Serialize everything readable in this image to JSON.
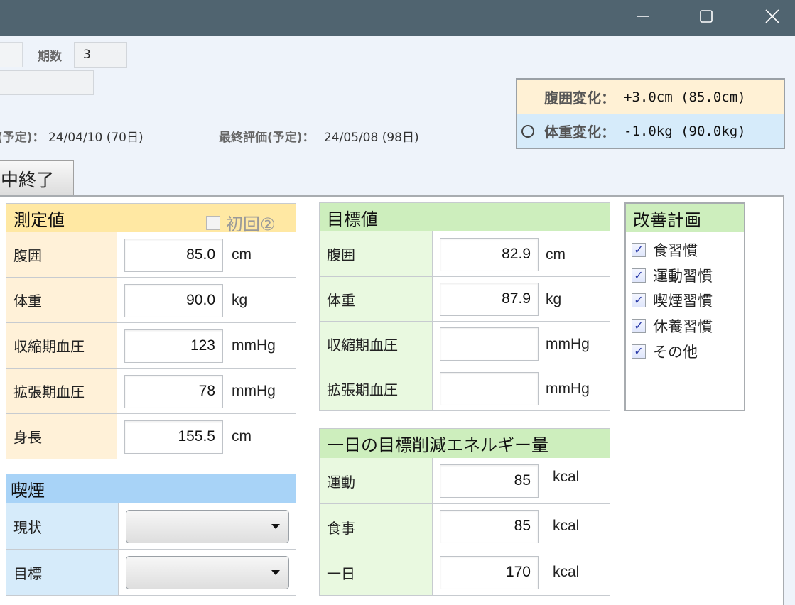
{
  "titlebar": {
    "minimize_icon": "minimize-icon",
    "maximize_icon": "maximize-icon",
    "close_icon": "close-icon"
  },
  "header": {
    "period_label": "期数",
    "period_value": "3",
    "schedule_mid_label": "(予定)：",
    "schedule_mid_value": "24/04/10 (70日)",
    "schedule_final_label": "最終評価(予定)：",
    "schedule_final_value": "24/05/08 (98日)"
  },
  "changes": {
    "waist_label": "腹囲変化：",
    "waist_value": "+3.0cm (85.0cm)",
    "weight_label": "体重変化：",
    "weight_value": "-1.0kg (90.0kg)"
  },
  "tab": {
    "label": "中終了"
  },
  "measurements": {
    "title": "測定値",
    "first_label": "初回②",
    "rows": [
      {
        "label": "腹囲",
        "value": "85.0",
        "unit": "cm"
      },
      {
        "label": "体重",
        "value": "90.0",
        "unit": "kg"
      },
      {
        "label": "収縮期血圧",
        "value": "123",
        "unit": "mmHg"
      },
      {
        "label": "拡張期血圧",
        "value": "78",
        "unit": "mmHg"
      },
      {
        "label": "身長",
        "value": "155.5",
        "unit": "cm"
      }
    ]
  },
  "targets": {
    "title": "目標値",
    "rows": [
      {
        "label": "腹囲",
        "value": "82.9",
        "unit": "cm"
      },
      {
        "label": "体重",
        "value": "87.9",
        "unit": "kg"
      },
      {
        "label": "収縮期血圧",
        "value": "",
        "unit": "mmHg"
      },
      {
        "label": "拡張期血圧",
        "value": "",
        "unit": "mmHg"
      }
    ]
  },
  "plan": {
    "title": "改善計画",
    "items": [
      {
        "label": "食習慣",
        "checked": true
      },
      {
        "label": "運動習慣",
        "checked": true
      },
      {
        "label": "喫煙習慣",
        "checked": true
      },
      {
        "label": "休養習慣",
        "checked": true
      },
      {
        "label": "その他",
        "checked": true
      }
    ]
  },
  "smoking": {
    "title": "喫煙",
    "rows": [
      {
        "label": "現状",
        "value": ""
      },
      {
        "label": "目標",
        "value": ""
      }
    ]
  },
  "energy": {
    "title": "一日の目標削減エネルギー量",
    "rows": [
      {
        "label": "運動",
        "value": "85",
        "unit": "kcal"
      },
      {
        "label": "食事",
        "value": "85",
        "unit": "kcal"
      },
      {
        "label": "一日",
        "value": "170",
        "unit": "kcal"
      }
    ]
  },
  "colors": {
    "titlebar": "#506470",
    "measure_header": "#ffe8a3",
    "measure_label_bg": "#fff1d8",
    "target_header": "#cdeebd",
    "target_label_bg": "#e9f9e0",
    "smoking_header": "#a8d3f7",
    "smoking_label_bg": "#d6ebfa"
  }
}
